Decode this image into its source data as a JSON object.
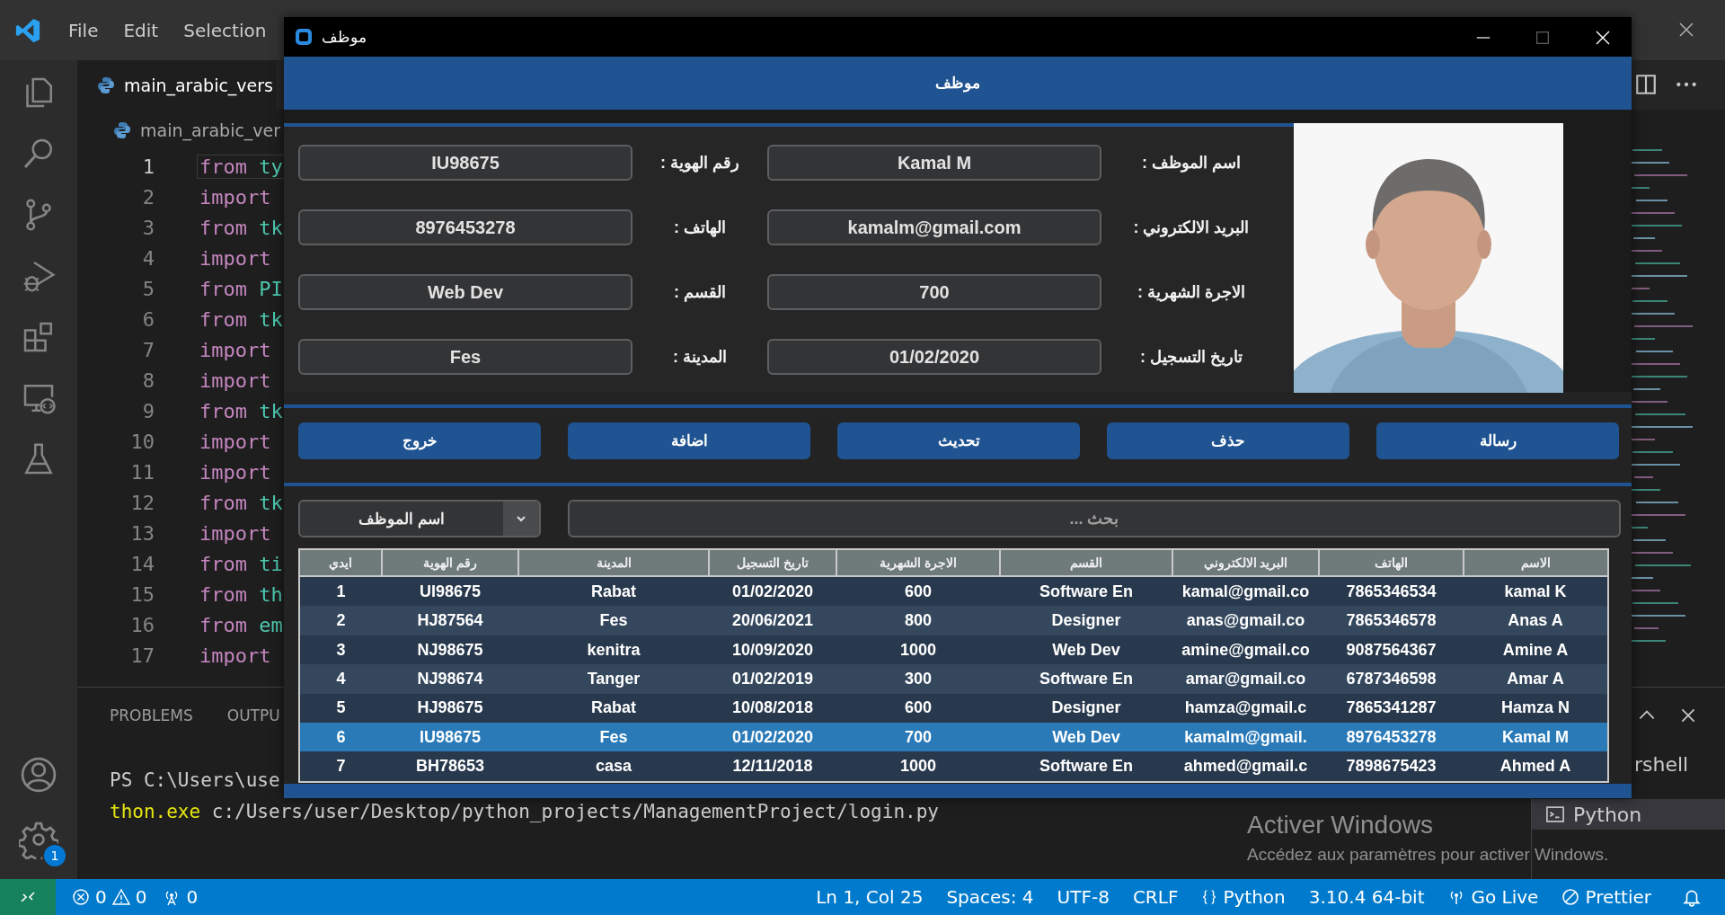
{
  "ide": {
    "menu": [
      "File",
      "Edit",
      "Selection"
    ],
    "tab_title": "main_arabic_vers",
    "breadcrumb": "main_arabic_ver",
    "code_lines": [
      {
        "number": "1",
        "keyword": "from",
        "rest": "ty",
        "current": true
      },
      {
        "number": "2",
        "keyword": "import",
        "current": false
      },
      {
        "number": "3",
        "keyword": "from",
        "rest": "tk",
        "current": false
      },
      {
        "number": "4",
        "keyword": "import",
        "current": false
      },
      {
        "number": "5",
        "keyword": "from",
        "rest": "PI",
        "current": false
      },
      {
        "number": "6",
        "keyword": "from",
        "rest": "tk",
        "current": false
      },
      {
        "number": "7",
        "keyword": "import",
        "current": false
      },
      {
        "number": "8",
        "keyword": "import",
        "current": false
      },
      {
        "number": "9",
        "keyword": "from",
        "rest": "tk",
        "current": false
      },
      {
        "number": "10",
        "keyword": "import",
        "current": false
      },
      {
        "number": "11",
        "keyword": "import",
        "current": false
      },
      {
        "number": "12",
        "keyword": "from",
        "rest": "tk",
        "current": false
      },
      {
        "number": "13",
        "keyword": "import",
        "current": false
      },
      {
        "number": "14",
        "keyword": "from",
        "rest": "ti",
        "current": false
      },
      {
        "number": "15",
        "keyword": "from",
        "rest": "th",
        "current": false
      },
      {
        "number": "16",
        "keyword": "from",
        "rest": "em",
        "current": false
      },
      {
        "number": "17",
        "keyword": "import",
        "current": false
      }
    ],
    "panel_tabs": [
      "PROBLEMS",
      "OUTPU"
    ],
    "terminal": {
      "prompt": "PS C:\\Users\\use",
      "command": "thon.exe",
      "path": "c:/Users/user/Desktop/python_projects/ManagementProject/login.py"
    },
    "terminals": [
      {
        "label": "rshell",
        "selected": false
      },
      {
        "label": "Python",
        "selected": true
      }
    ],
    "settings_badge": "1",
    "activation": {
      "title": "Activer Windows",
      "message": "Accédez aux paramètres pour activer Windows."
    }
  },
  "status_bar": {
    "errors": "0",
    "warnings": "0",
    "ports": "0",
    "items": [
      "Ln 1, Col 25",
      "Spaces: 4",
      "UTF-8",
      "CRLF"
    ],
    "language": "Python",
    "interpreter": "3.10.4 64-bit",
    "go_live": "Go Live",
    "prettier": "Prettier"
  },
  "app": {
    "window_title": "موظف",
    "header": "موظف",
    "form": [
      {
        "kind": "field",
        "text": "IU98675"
      },
      {
        "kind": "label",
        "text": "رقم الهوية :"
      },
      {
        "kind": "field",
        "text": "Kamal M"
      },
      {
        "kind": "label",
        "text": "اسم الموظف :"
      },
      {
        "kind": "field",
        "text": "8976453278"
      },
      {
        "kind": "label",
        "text": "الهاتف :"
      },
      {
        "kind": "field",
        "text": "kamalm@gmail.com"
      },
      {
        "kind": "label",
        "text": "البريد الالكتروني :"
      },
      {
        "kind": "field",
        "text": "Web Dev"
      },
      {
        "kind": "label",
        "text": "القسم :"
      },
      {
        "kind": "field",
        "text": "700"
      },
      {
        "kind": "label",
        "text": "الاجرة الشهرية :"
      },
      {
        "kind": "field",
        "text": "Fes"
      },
      {
        "kind": "label",
        "text": "المدينة :"
      },
      {
        "kind": "field",
        "text": "01/02/2020"
      },
      {
        "kind": "label",
        "text": "تاريخ التسجيل :"
      }
    ],
    "buttons": [
      "رسالة",
      "حذف",
      "تحديث",
      "اضافة",
      "خروج"
    ],
    "search_by": "اسم الموظف",
    "search_placeholder": "بحث ...",
    "table": {
      "columns": [
        "ايدي",
        "رقم الهوية",
        "المدينة",
        "تاريخ التسجيل",
        "الاجرة الشهرية",
        "القسم",
        "البريد الالكتروني",
        "الهاتف",
        "الاسم"
      ],
      "rows": [
        {
          "cells": [
            "1",
            "UI98675",
            "Rabat",
            "01/02/2020",
            "600",
            "Software En",
            "kamal@gmail.co",
            "7865346534",
            "kamal K"
          ],
          "selected": false
        },
        {
          "cells": [
            "2",
            "HJ87564",
            "Fes",
            "20/06/2021",
            "800",
            "Designer",
            "anas@gmail.co",
            "7865346578",
            "Anas A"
          ],
          "selected": false
        },
        {
          "cells": [
            "3",
            "NJ98675",
            "kenitra",
            "10/09/2020",
            "1000",
            "Web Dev",
            "amine@gmail.co",
            "9087564367",
            "Amine A"
          ],
          "selected": false
        },
        {
          "cells": [
            "4",
            "NJ98674",
            "Tanger",
            "01/02/2019",
            "300",
            "Software En",
            "amar@gmail.co",
            "6787346598",
            "Amar A"
          ],
          "selected": false
        },
        {
          "cells": [
            "5",
            "HJ98675",
            "Rabat",
            "10/08/2018",
            "600",
            "Designer",
            "hamza@gmail.c",
            "7865341287",
            "Hamza N"
          ],
          "selected": false
        },
        {
          "cells": [
            "6",
            "IU98675",
            "Fes",
            "01/02/2020",
            "700",
            "Web Dev",
            "kamalm@gmail.",
            "8976453278",
            "Kamal M"
          ],
          "selected": true
        },
        {
          "cells": [
            "7",
            "BH78653",
            "casa",
            "12/11/2018",
            "1000",
            "Software En",
            "ahmed@gmail.c",
            "7898675423",
            "Ahmed A"
          ],
          "selected": false
        }
      ]
    }
  }
}
